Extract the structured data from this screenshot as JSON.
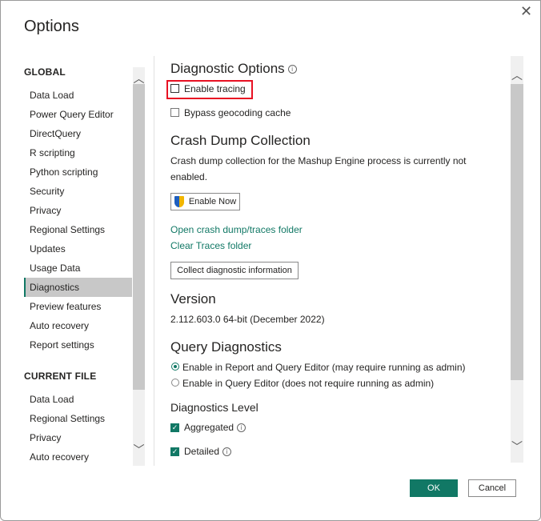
{
  "dialog": {
    "title": "Options",
    "close_label": "✕"
  },
  "sidebar": {
    "global_heading": "GLOBAL",
    "global_items": [
      {
        "label": "Data Load"
      },
      {
        "label": "Power Query Editor"
      },
      {
        "label": "DirectQuery"
      },
      {
        "label": "R scripting"
      },
      {
        "label": "Python scripting"
      },
      {
        "label": "Security"
      },
      {
        "label": "Privacy"
      },
      {
        "label": "Regional Settings"
      },
      {
        "label": "Updates"
      },
      {
        "label": "Usage Data"
      },
      {
        "label": "Diagnostics",
        "selected": true
      },
      {
        "label": "Preview features"
      },
      {
        "label": "Auto recovery"
      },
      {
        "label": "Report settings"
      }
    ],
    "current_heading": "CURRENT FILE",
    "current_items": [
      {
        "label": "Data Load"
      },
      {
        "label": "Regional Settings"
      },
      {
        "label": "Privacy"
      },
      {
        "label": "Auto recovery"
      }
    ]
  },
  "main": {
    "diag_heading": "Diagnostic Options",
    "enable_tracing": {
      "label": "Enable tracing",
      "checked": false
    },
    "bypass_geocoding": {
      "label": "Bypass geocoding cache",
      "checked": false
    },
    "crash_heading": "Crash Dump Collection",
    "crash_text_1": "Crash dump collection for the Mashup Engine process is currently not",
    "crash_text_2": "enabled.",
    "enable_now_label": "Enable Now",
    "open_folder_link": "Open crash dump/traces folder",
    "clear_traces_link": "Clear Traces folder",
    "collect_label": "Collect diagnostic information",
    "version_heading": "Version",
    "version_text": "2.112.603.0 64-bit (December 2022)",
    "query_heading": "Query Diagnostics",
    "radio_1": {
      "label": "Enable in Report and Query Editor (may require running as admin)",
      "selected": true
    },
    "radio_2": {
      "label": "Enable in Query Editor (does not require running as admin)",
      "selected": false
    },
    "level_heading": "Diagnostics Level",
    "aggregated": {
      "label": "Aggregated",
      "checked": true
    },
    "detailed": {
      "label": "Detailed",
      "checked": true
    }
  },
  "footer": {
    "ok_label": "OK",
    "cancel_label": "Cancel"
  },
  "colors": {
    "accent": "#117865",
    "highlight": "#e81123"
  }
}
